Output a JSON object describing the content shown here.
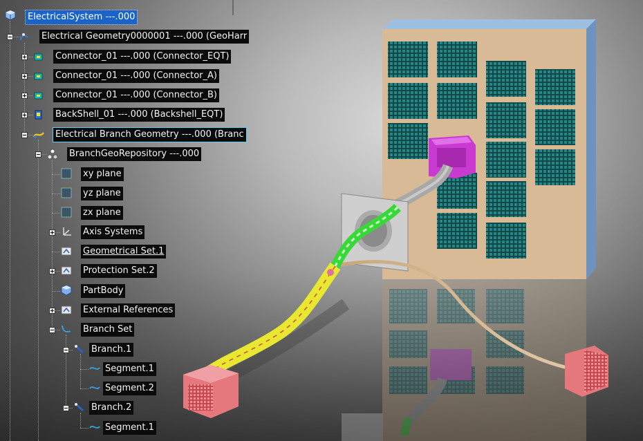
{
  "tree": {
    "root": "ElectricalSystem ---.000",
    "geometry": "Electrical Geometry0000001 ---.000 (GeoHarr",
    "connector_eqt": "Connector_01 ---.000 (Connector_EQT)",
    "connector_a": "Connector_01 ---.000 (Connector_A)",
    "connector_b": "Connector_01 ---.000 (Connector_B)",
    "backshell": "BackShell_01 ---.000 (Backshell_EQT)",
    "branch_geometry": "Electrical Branch Geometry ---.000 (Branc",
    "repository": "BranchGeoRepository ---.000",
    "xy_plane": "xy plane",
    "yz_plane": "yz plane",
    "zx_plane": "zx plane",
    "axis_systems": "Axis Systems",
    "geometrical_set": "Geometrical Set.1",
    "protection_set": "Protection Set.2",
    "part_body": "PartBody",
    "external_refs": "External References",
    "branch_set": "Branch Set",
    "branch1": "Branch.1",
    "branch1_seg1": "Segment.1",
    "branch1_seg2": "Segment.2",
    "branch2": "Branch.2",
    "branch2_seg1": "Segment.1"
  },
  "colors": {
    "selection": "#1a64c8",
    "panel": "#d8ba96",
    "panel_side": "#8fb2d8",
    "slot": "#1f6e6e",
    "connector_pink": "#e4787c",
    "backshell_magenta": "#c83ad0",
    "bundle_yellow": "#e8e830",
    "bundle_green": "#38d838"
  },
  "icons": {
    "root": "product-icon",
    "geometry": "geometry-icon",
    "connector": "connector-icon",
    "plane": "plane-icon",
    "axis": "axis-system-icon",
    "geoset": "geometrical-set-icon",
    "body": "part-body-icon",
    "branch": "branch-icon",
    "segment": "segment-icon"
  }
}
